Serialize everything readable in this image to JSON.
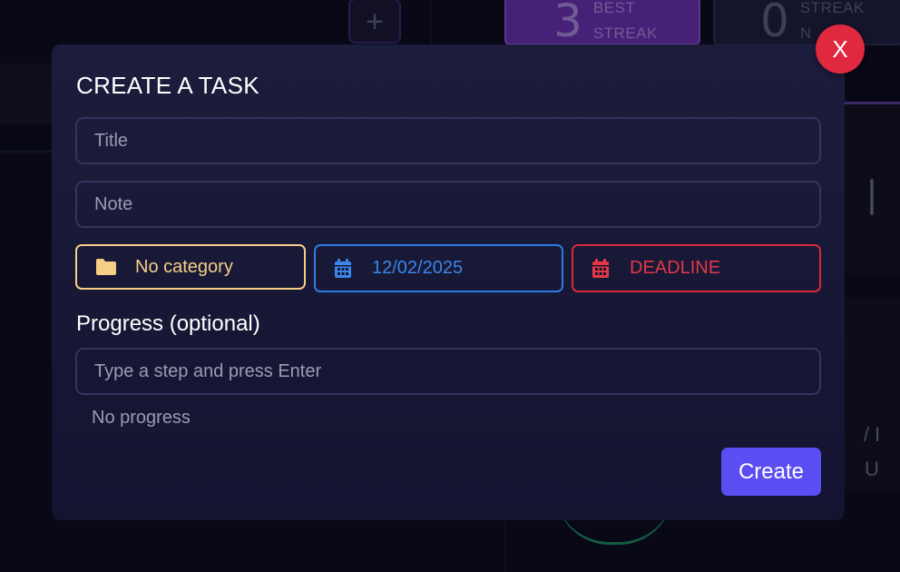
{
  "background": {
    "add_button_glyph": "+",
    "best_streak": {
      "value": "3",
      "label_line1": "BEST",
      "label_line2": "STREAK"
    },
    "streak": {
      "value": "0",
      "label_line1": "STREAK",
      "label_line2": "N"
    },
    "right_glyph": "|",
    "right_text_line1": "/ I",
    "right_text_line2": "U"
  },
  "modal": {
    "title": "CREATE A TASK",
    "close_label": "X",
    "title_placeholder": "Title",
    "note_placeholder": "Note",
    "category": {
      "label": "No category",
      "icon": "folder-icon",
      "color": "#f6cf86"
    },
    "date": {
      "value": "12/02/2025",
      "icon": "calendar-icon",
      "color": "#3a86ea"
    },
    "deadline": {
      "label": "DEADLINE",
      "icon": "calendar-icon",
      "color": "#e43847"
    },
    "progress_heading": "Progress (optional)",
    "step_placeholder": "Type a step and press Enter",
    "no_progress_text": "No progress",
    "create_label": "Create",
    "accent_color": "#5b4ef2",
    "close_color": "#e0293f"
  }
}
